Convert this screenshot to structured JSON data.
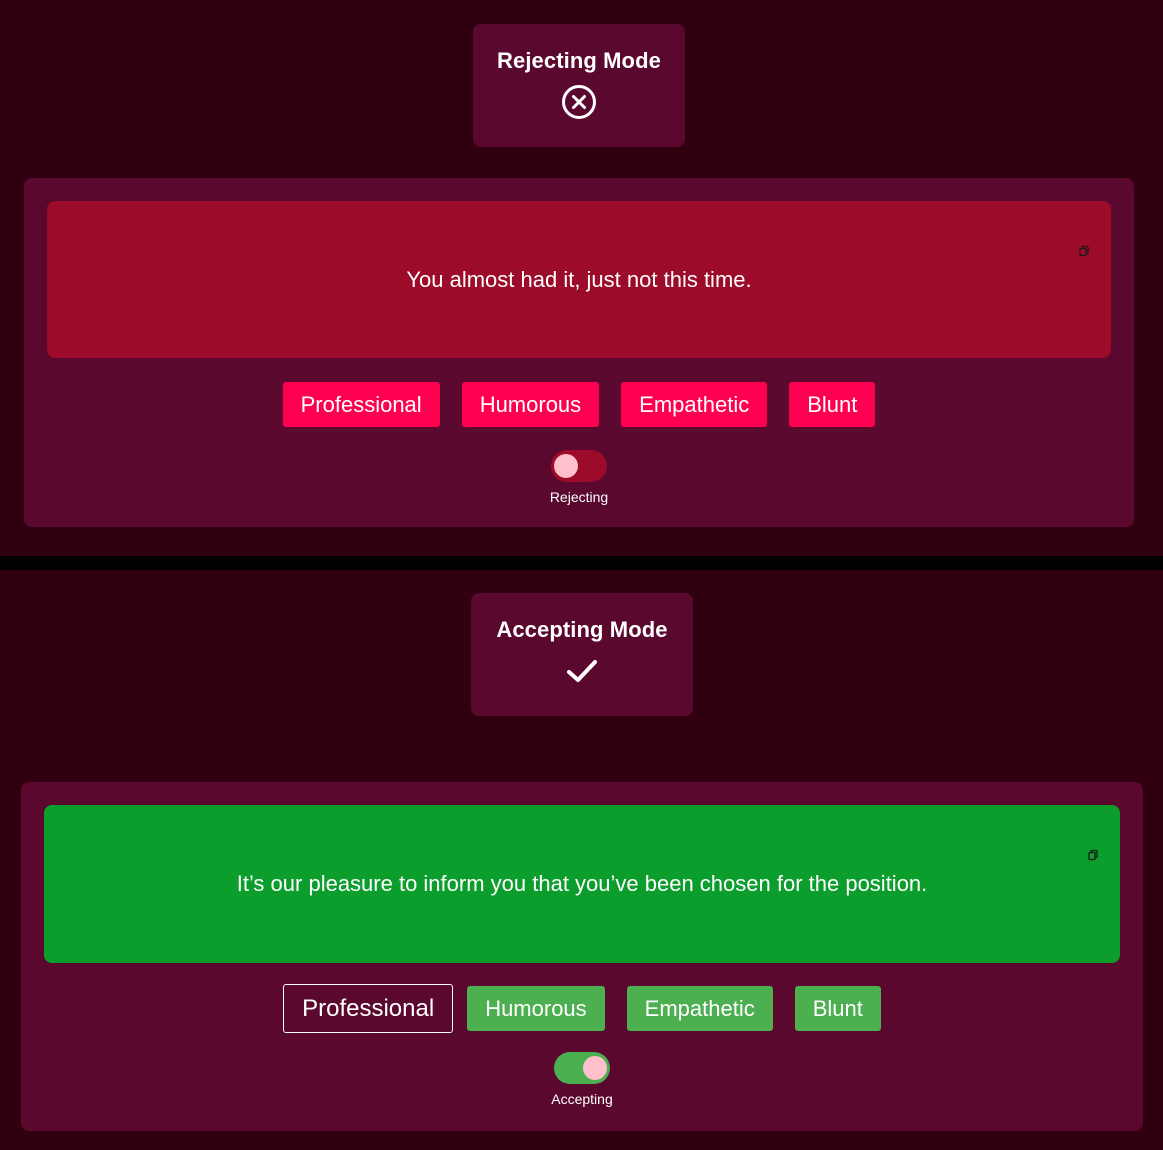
{
  "rejecting": {
    "mode_title": "Rejecting Mode",
    "mode_icon": "x-circle-icon",
    "message": "You almost had it, just not this time.",
    "message_bg": "#9c0b29",
    "tones": [
      "Professional",
      "Humorous",
      "Empathetic",
      "Blunt"
    ],
    "tone_color": "#ff0050",
    "toggle_label": "Rejecting",
    "toggle_on": false,
    "toggle_color": "#9c0b29"
  },
  "accepting": {
    "mode_title": "Accepting Mode",
    "mode_icon": "checkmark-icon",
    "message": "It’s our pleasure to inform you that you’ve been chosen for the position.",
    "message_bg": "#0c9e2c",
    "tones": [
      "Professional",
      "Humorous",
      "Empathetic",
      "Blunt"
    ],
    "selected_tone": "Professional",
    "tone_color": "#4caf50",
    "toggle_label": "Accepting",
    "toggle_on": true,
    "toggle_color": "#4caf50"
  },
  "colors": {
    "page_bg": "#300010",
    "card_bg": "#5b082e",
    "divider": "#000000",
    "knob": "#ffc0cb"
  },
  "icons": {
    "copy": "copy-icon"
  }
}
